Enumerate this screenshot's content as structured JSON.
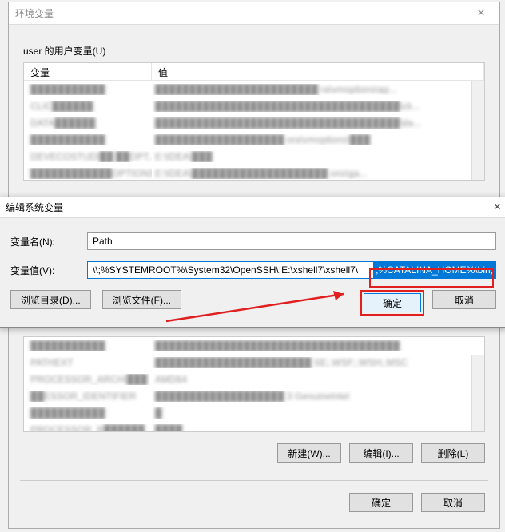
{
  "dialog1": {
    "title": "环境变量",
    "user_vars_label": "user 的用户变量(U)",
    "table": {
      "col1": "变量",
      "col2": "值",
      "rows": [
        {
          "var": "███████████",
          "val": "████████████████████████ ra\\vmoptions\\ap..."
        },
        {
          "var": "CLIC██████",
          "val": "████████████████████████████████████\\cli..."
        },
        {
          "var": "DATA██████",
          "val": "████████████████████████████████████\\da..."
        },
        {
          "var": "███████████",
          "val": "███████████████████ ora\\vmoptions\\███"
        },
        {
          "var": "DEVECOSTUDI██ ██OPT...",
          "val": "E:\\IDEA\\███"
        },
        {
          "var": "████████████OPTIONS",
          "val": "E:\\IDEA\\████████████████████ ons\\ga..."
        }
      ]
    },
    "sys_table": {
      "rows": [
        {
          "var": "███████████",
          "val": "████████████████████████████████████"
        },
        {
          "var": "PATHEXT",
          "val": "███████████████████████ SE;.WSF;.WSH;.MSC"
        },
        {
          "var": "PROCESSOR_ARCHI███",
          "val": "AMD64"
        },
        {
          "var": "██ESSOR_IDENTIFIER",
          "val": "███████████████████ 3  GenuineIntel"
        },
        {
          "var": "███████████",
          "val": "█"
        },
        {
          "var": "PROCESSOR_R██████",
          "val": "████"
        }
      ]
    },
    "buttons": {
      "new": "新建(W)...",
      "edit": "编辑(I)...",
      "delete": "删除(L)",
      "ok": "确定",
      "cancel": "取消"
    }
  },
  "dialog2": {
    "title": "编辑系统变量",
    "name_label": "变量名(N):",
    "name_value": "Path",
    "value_label": "变量值(V):",
    "value_text": "\\\\;%SYSTEMROOT%\\System32\\OpenSSH\\;E:\\xshell7\\xshell7\\",
    "value_highlight": ";%CATALINA_HOME%\\bin;",
    "buttons": {
      "browse_dir": "浏览目录(D)...",
      "browse_file": "浏览文件(F)...",
      "ok": "确定",
      "cancel": "取消"
    }
  }
}
